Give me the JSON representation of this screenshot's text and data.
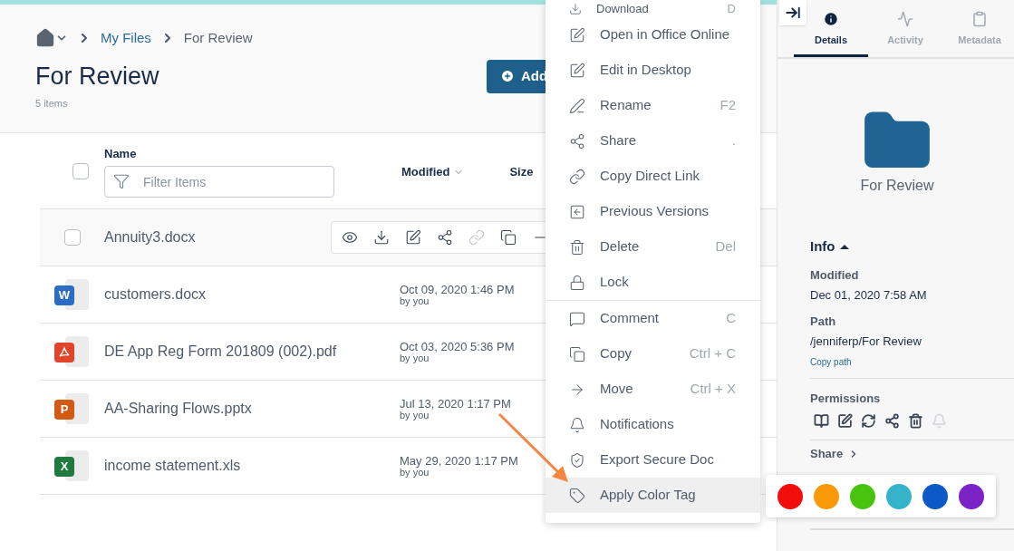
{
  "breadcrumb": {
    "items": [
      {
        "label": "My Files",
        "link": true
      },
      {
        "label": "For Review",
        "link": false
      }
    ]
  },
  "header": {
    "title": "For Review",
    "count": "5 items",
    "add_button": "Add"
  },
  "table": {
    "select_all": {
      "checked": false
    },
    "name_column": "Name",
    "filter": {
      "placeholder": "Filter Items"
    },
    "columns": [
      "Modified",
      "Size"
    ],
    "rows": [
      {
        "name": "Annuity3.docx",
        "hovered": true,
        "checked": false,
        "actions": [
          {
            "enabled": true
          },
          {
            "enabled": true
          },
          {
            "enabled": true
          },
          {
            "enabled": true
          },
          {
            "enabled": false
          },
          {
            "enabled": true
          },
          {
            "enabled": true
          }
        ]
      },
      {
        "name": "customers.docx",
        "hovered": false,
        "kind": "word",
        "badge": "W",
        "modified": "Oct 09, 2020 1:46 PM",
        "by": "by you"
      },
      {
        "name": "DE App Reg Form 201809 (002).pdf",
        "hovered": false,
        "kind": "pdf",
        "modified": "Oct 03, 2020 5:36 PM",
        "by": "by you"
      },
      {
        "name": "AA-Sharing Flows.pptx",
        "hovered": false,
        "kind": "powerpoint",
        "badge": "P",
        "modified": "Jul 13, 2020 1:17 PM",
        "by": "by you"
      },
      {
        "name": "income statement.xls",
        "hovered": false,
        "kind": "excel",
        "badge": "X",
        "modified": "May 29, 2020 1:17 PM",
        "by": "by you"
      }
    ]
  },
  "context_menu": {
    "groups": [
      [
        {
          "label": "Download",
          "shortcut": "D",
          "highlighted": false
        },
        {
          "label": "Open in Office Online",
          "highlighted": false
        },
        {
          "label": "Edit in Desktop",
          "highlighted": false
        },
        {
          "label": "Rename",
          "shortcut": "F2",
          "highlighted": false
        },
        {
          "label": "Share",
          "shortcut": ".",
          "highlighted": false
        },
        {
          "label": "Copy Direct Link",
          "highlighted": false
        },
        {
          "label": "Previous Versions",
          "highlighted": false
        },
        {
          "label": "Delete",
          "shortcut": "Del",
          "highlighted": false
        },
        {
          "label": "Lock",
          "highlighted": false
        }
      ],
      [
        {
          "label": "Comment",
          "shortcut": "C",
          "highlighted": false
        },
        {
          "label": "Copy",
          "shortcut": "Ctrl + C",
          "highlighted": false
        },
        {
          "label": "Move",
          "shortcut": "Ctrl + X",
          "highlighted": false
        },
        {
          "label": "Notifications",
          "highlighted": false
        },
        {
          "label": "Export Secure Doc",
          "highlighted": false
        },
        {
          "label": "Apply Color Tag",
          "highlighted": true
        }
      ]
    ]
  },
  "color_tags": [
    {
      "color": "#f20d0d"
    },
    {
      "color": "#f99a06"
    },
    {
      "color": "#47c40d"
    },
    {
      "color": "#35b3c8"
    },
    {
      "color": "#0c59c8"
    },
    {
      "color": "#7c23c8"
    }
  ],
  "details_panel": {
    "tabs": [
      {
        "label": "Details",
        "selected": true
      },
      {
        "label": "Activity",
        "selected": false
      },
      {
        "label": "Metadata",
        "selected": false
      }
    ],
    "folder_name": "For Review",
    "info_heading": "Info",
    "info_expanded": true,
    "modified_label": "Modified",
    "modified_value": "Dec 01, 2020 7:58 AM",
    "path_label": "Path",
    "path_value": "/jenniferp/For Review",
    "copy_path": "Copy path",
    "permissions_heading": "Permissions",
    "permissions": [
      {
        "enabled": true
      },
      {
        "enabled": true
      },
      {
        "enabled": true
      },
      {
        "enabled": true
      },
      {
        "enabled": true
      },
      {
        "enabled": false
      }
    ],
    "share_heading": "Share"
  }
}
